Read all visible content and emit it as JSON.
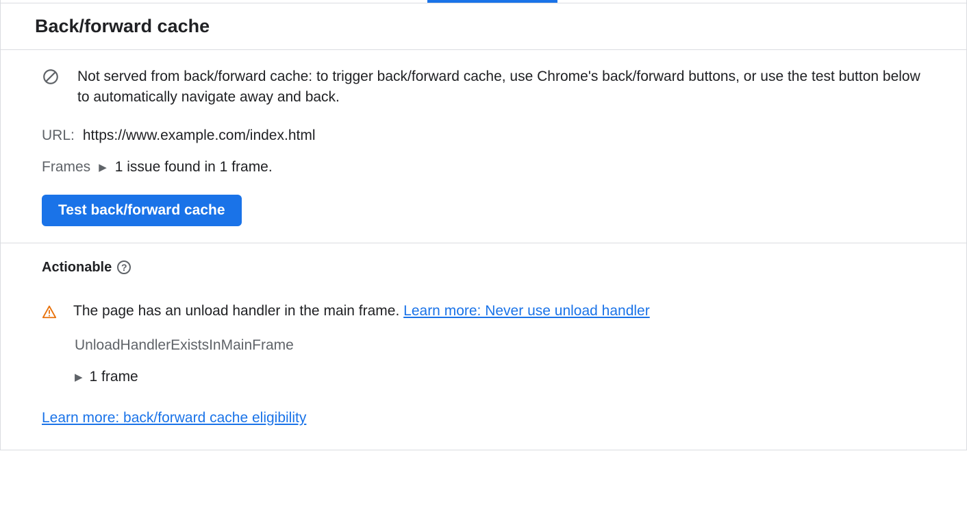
{
  "header": {
    "title": "Back/forward cache"
  },
  "info": {
    "message": "Not served from back/forward cache: to trigger back/forward cache, use Chrome's back/forward buttons, or use the test button below to automatically navigate away and back."
  },
  "url": {
    "label": "URL:",
    "value": "https://www.example.com/index.html"
  },
  "frames": {
    "label": "Frames",
    "summary": "1 issue found in 1 frame."
  },
  "test_button": "Test back/forward cache",
  "actionable": {
    "heading": "Actionable",
    "issue_text": "The page has an unload handler in the main frame. ",
    "issue_link": "Learn more: Never use unload handler",
    "issue_code": "UnloadHandlerExistsInMainFrame",
    "frame_count": "1 frame"
  },
  "bottom_link": "Learn more: back/forward cache eligibility"
}
